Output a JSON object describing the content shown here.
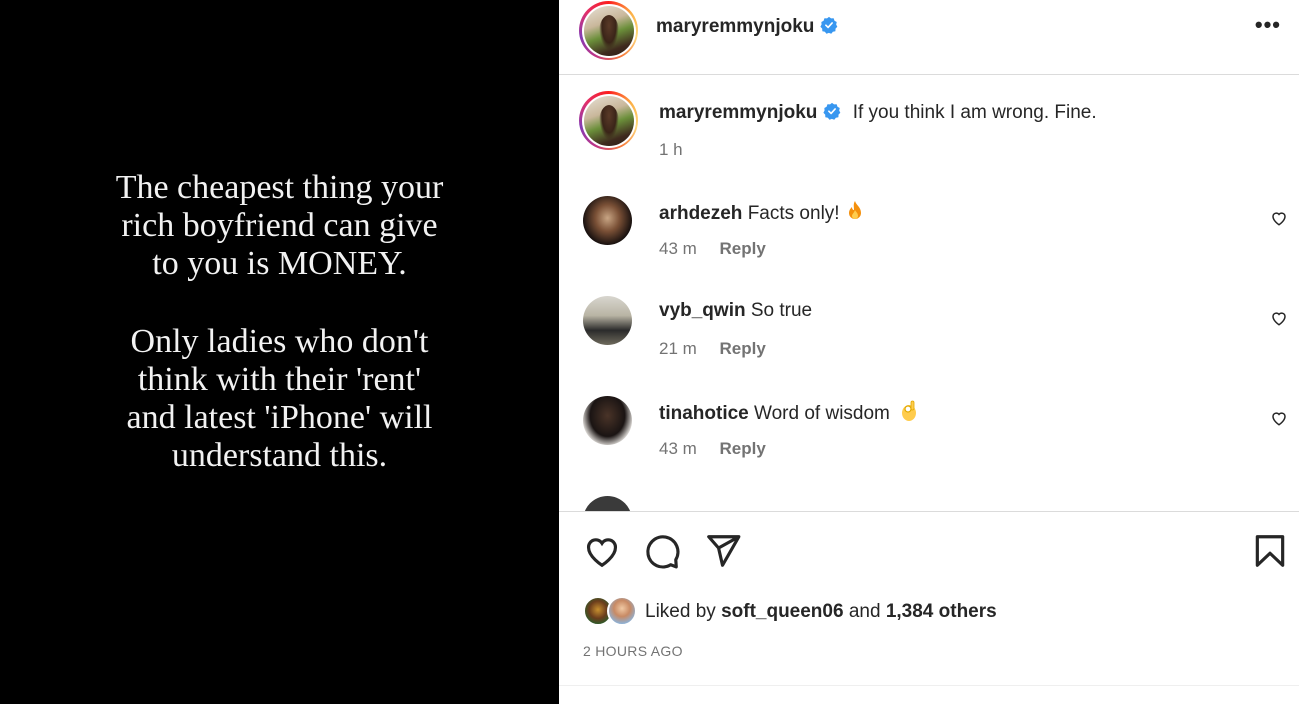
{
  "post": {
    "text_blocks": [
      "The cheapest thing your\nrich boyfriend can give\nto you is MONEY.",
      "Only ladies who don't\nthink with their 'rent'\nand latest 'iPhone' will\nunderstand this."
    ]
  },
  "header": {
    "username": "maryremmynjoku",
    "more_label": "•••"
  },
  "caption": {
    "username": "maryremmynjoku",
    "text": "If you think I am wrong. Fine.",
    "time": "1 h"
  },
  "comments": [
    {
      "username": "arhdezeh",
      "text": "Facts only!",
      "emoji": "fire-icon",
      "time": "43 m",
      "reply": "Reply"
    },
    {
      "username": "vyb_qwin",
      "text": "So true",
      "emoji": "",
      "time": "21 m",
      "reply": "Reply"
    },
    {
      "username": "tinahotice",
      "text": "Word of wisdom",
      "emoji": "ok-hand-icon",
      "time": "43 m",
      "reply": "Reply"
    }
  ],
  "likes": {
    "prefix": "Liked by",
    "first_liker": "soft_queen06",
    "joiner": "and",
    "others": "1,384 others"
  },
  "timestamp": "2 HOURS AGO",
  "colors": {
    "verified": "#3897f0",
    "muted": "#737373",
    "text": "#262626",
    "image_bg": "#000000"
  }
}
